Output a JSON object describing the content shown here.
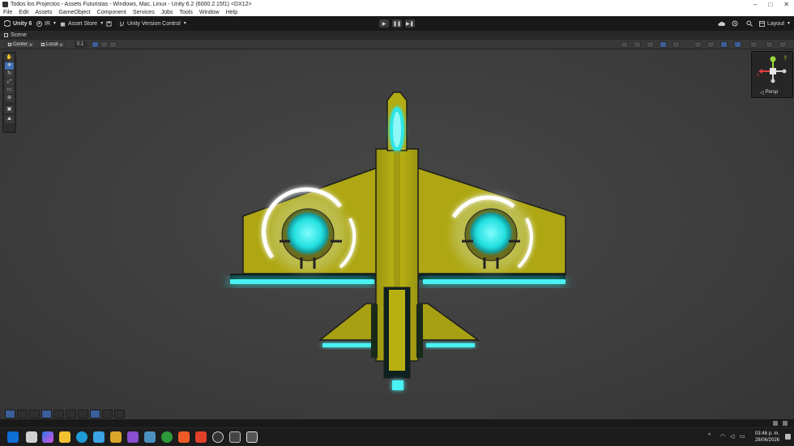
{
  "window": {
    "title": "Todos los Projectos - Assets Futuristas - Windows, Mac, Linux - Unity 6.2 (6000.2.15f1) <DX12>",
    "controls": [
      "–",
      "□",
      "✕"
    ]
  },
  "menu": [
    "File",
    "Edit",
    "Assets",
    "GameObject",
    "Component",
    "Services",
    "Jobs",
    "Tools",
    "Window",
    "Help"
  ],
  "toolbar": {
    "unity_label": "Unity 6",
    "account_label": "IR",
    "asset_store_label": "Asset Store",
    "version_control_label": "Unity Version Control",
    "layout_label": "Layout"
  },
  "scene_tab": {
    "label": "Scene"
  },
  "scene_bar": {
    "pivot_label": "Center",
    "space_label": "Local",
    "snap_value": "0.1"
  },
  "gizmo": {
    "axis_y": "y",
    "axis_x": "x",
    "persp_label": "Persp"
  },
  "tools": [
    "view-tool",
    "move-tool",
    "rotate-tool",
    "scale-tool",
    "rect-tool",
    "transform-tool",
    "custom-tool"
  ],
  "taskbar": {
    "time": "03:46 p. m.",
    "date": "28/06/2026",
    "apps": [
      "windows-start",
      "search",
      "copilot",
      "file-explorer",
      "edge",
      "vscode",
      "archive",
      "visual-studio",
      "task-manager",
      "xbox",
      "brave",
      "record",
      "notion",
      "unity-hub",
      "unity"
    ]
  },
  "colors": {
    "ship_body": "#b8b010",
    "ship_glow": "#2de6e6",
    "viewport_bg": "#414141",
    "toolbar_bg": "#191919",
    "accent": "#3f6fb5"
  }
}
